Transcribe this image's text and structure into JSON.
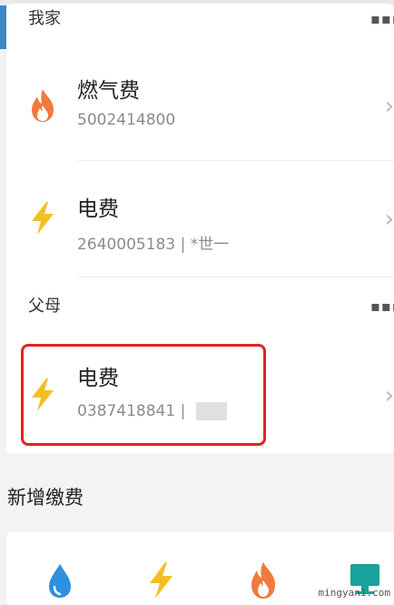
{
  "groups": [
    {
      "title": "我家",
      "items": [
        {
          "name": "燃气费",
          "account": "5002414800",
          "icon": "flame-icon"
        },
        {
          "name": "电费",
          "account": "2640005183 | *世一",
          "icon": "lightning-icon"
        }
      ]
    },
    {
      "title": "父母",
      "items": [
        {
          "name": "电费",
          "account": "0387418841 | ",
          "icon": "lightning-icon"
        }
      ]
    }
  ],
  "new_payment": {
    "title": "新增缴费",
    "tiles": [
      "water-drop-icon",
      "lightning-icon",
      "flame-icon",
      "tv-icon"
    ]
  },
  "watermark": "mingyan1.com",
  "colors": {
    "flame": "#f07a3e",
    "lightning": "#f5bf22",
    "water": "#2f8fe0",
    "tv": "#1aa39a",
    "highlight": "#e02424"
  }
}
